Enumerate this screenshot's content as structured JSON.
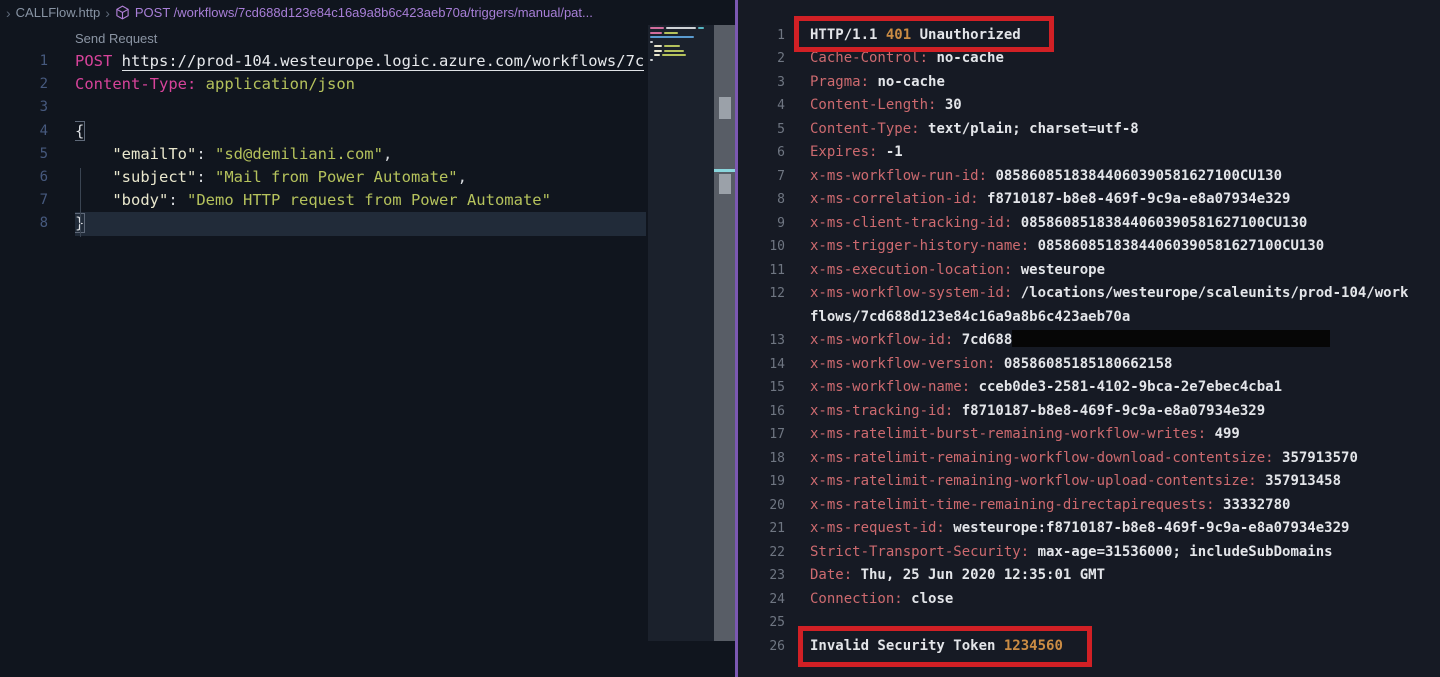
{
  "breadcrumb": {
    "root_chevron": "›",
    "file_label": "CALLFlow.http",
    "chevron": "›",
    "symbol_label": "POST /workflows/7cd688d123e84c16a9a8b6c423aeb70a/triggers/manual/pat..."
  },
  "request_editor": {
    "codelens_label": "Send Request",
    "lines": [
      {
        "n": "1",
        "seg": [
          [
            "kw",
            "POST "
          ],
          [
            "url",
            "https://prod-104.westeurope.logic.azure.com/workflows/7c"
          ]
        ]
      },
      {
        "n": "2",
        "seg": [
          [
            "kw",
            "Content-Type:"
          ],
          [
            "plain",
            " "
          ],
          [
            "str",
            "application/json"
          ]
        ]
      },
      {
        "n": "3",
        "seg": []
      },
      {
        "n": "4",
        "seg": [
          [
            "brace",
            "{"
          ]
        ]
      },
      {
        "n": "5",
        "seg": [
          [
            "plain",
            "    "
          ],
          [
            "key",
            "\"emailTo\""
          ],
          [
            "plain",
            ": "
          ],
          [
            "str",
            "\"sd@demiliani.com\""
          ],
          [
            "plain",
            ","
          ]
        ]
      },
      {
        "n": "6",
        "seg": [
          [
            "plain",
            "    "
          ],
          [
            "key",
            "\"subject\""
          ],
          [
            "plain",
            ": "
          ],
          [
            "str",
            "\"Mail from Power Automate\""
          ],
          [
            "plain",
            ","
          ]
        ]
      },
      {
        "n": "7",
        "seg": [
          [
            "plain",
            "    "
          ],
          [
            "key",
            "\"body\""
          ],
          [
            "plain",
            ": "
          ],
          [
            "str",
            "\"Demo HTTP request from Power Automate\""
          ]
        ]
      },
      {
        "n": "8",
        "cur": true,
        "seg": [
          [
            "brace",
            "}"
          ]
        ]
      }
    ]
  },
  "response_viewer": {
    "lines": [
      {
        "n": "1",
        "seg": [
          [
            "val",
            "HTTP/1.1 "
          ],
          [
            "num",
            "401"
          ],
          [
            "val",
            " Unauthorized"
          ]
        ]
      },
      {
        "n": "2",
        "seg": [
          [
            "hdr",
            "Cache-Control: "
          ],
          [
            "val",
            "no-cache"
          ]
        ]
      },
      {
        "n": "3",
        "seg": [
          [
            "hdr",
            "Pragma: "
          ],
          [
            "val",
            "no-cache"
          ]
        ]
      },
      {
        "n": "4",
        "seg": [
          [
            "hdr",
            "Content-Length: "
          ],
          [
            "val",
            "30"
          ]
        ]
      },
      {
        "n": "5",
        "seg": [
          [
            "hdr",
            "Content-Type: "
          ],
          [
            "val",
            "text/plain; charset=utf-8"
          ]
        ]
      },
      {
        "n": "6",
        "seg": [
          [
            "hdr",
            "Expires: "
          ],
          [
            "val",
            "-1"
          ]
        ]
      },
      {
        "n": "7",
        "seg": [
          [
            "hdr",
            "x-ms-workflow-run-id: "
          ],
          [
            "val",
            "08586085183844060390581627100CU130"
          ]
        ]
      },
      {
        "n": "8",
        "seg": [
          [
            "hdr",
            "x-ms-correlation-id: "
          ],
          [
            "val",
            "f8710187-b8e8-469f-9c9a-e8a07934e329"
          ]
        ]
      },
      {
        "n": "9",
        "seg": [
          [
            "hdr",
            "x-ms-client-tracking-id: "
          ],
          [
            "val",
            "08586085183844060390581627100CU130"
          ]
        ]
      },
      {
        "n": "10",
        "seg": [
          [
            "hdr",
            "x-ms-trigger-history-name: "
          ],
          [
            "val",
            "08586085183844060390581627100CU130"
          ]
        ]
      },
      {
        "n": "11",
        "seg": [
          [
            "hdr",
            "x-ms-execution-location: "
          ],
          [
            "val",
            "westeurope"
          ]
        ]
      },
      {
        "n": "12",
        "seg": [
          [
            "hdr",
            "x-ms-workflow-system-id: "
          ],
          [
            "val",
            "/locations/westeurope/scaleunits/prod-104/work"
          ]
        ]
      },
      {
        "n": "",
        "seg": [
          [
            "val",
            "flows/7cd688d123e84c16a9a8b6c423aeb70a"
          ]
        ]
      },
      {
        "n": "13",
        "seg": [
          [
            "hdr",
            "x-ms-workflow-id: "
          ],
          [
            "val",
            "7cd688"
          ],
          [
            "redact",
            ""
          ]
        ]
      },
      {
        "n": "14",
        "seg": [
          [
            "hdr",
            "x-ms-workflow-version: "
          ],
          [
            "val",
            "08586085185180662158"
          ]
        ]
      },
      {
        "n": "15",
        "seg": [
          [
            "hdr",
            "x-ms-workflow-name: "
          ],
          [
            "val",
            "cceb0de3-2581-4102-9bca-2e7ebec4cba1"
          ]
        ]
      },
      {
        "n": "16",
        "seg": [
          [
            "hdr",
            "x-ms-tracking-id: "
          ],
          [
            "val",
            "f8710187-b8e8-469f-9c9a-e8a07934e329"
          ]
        ]
      },
      {
        "n": "17",
        "seg": [
          [
            "hdr",
            "x-ms-ratelimit-burst-remaining-workflow-writes: "
          ],
          [
            "val",
            "499"
          ]
        ]
      },
      {
        "n": "18",
        "seg": [
          [
            "hdr",
            "x-ms-ratelimit-remaining-workflow-download-contentsize: "
          ],
          [
            "val",
            "357913570"
          ]
        ]
      },
      {
        "n": "19",
        "seg": [
          [
            "hdr",
            "x-ms-ratelimit-remaining-workflow-upload-contentsize: "
          ],
          [
            "val",
            "357913458"
          ]
        ]
      },
      {
        "n": "20",
        "seg": [
          [
            "hdr",
            "x-ms-ratelimit-time-remaining-directapirequests: "
          ],
          [
            "val",
            "33332780"
          ]
        ]
      },
      {
        "n": "21",
        "seg": [
          [
            "hdr",
            "x-ms-request-id: "
          ],
          [
            "val",
            "westeurope:f8710187-b8e8-469f-9c9a-e8a07934e329"
          ]
        ]
      },
      {
        "n": "22",
        "seg": [
          [
            "hdr",
            "Strict-Transport-Security: "
          ],
          [
            "val",
            "max-age=31536000; includeSubDomains"
          ]
        ]
      },
      {
        "n": "23",
        "seg": [
          [
            "hdr",
            "Date: "
          ],
          [
            "val",
            "Thu, 25 Jun 2020 12:35:01 GMT"
          ]
        ]
      },
      {
        "n": "24",
        "seg": [
          [
            "hdr",
            "Connection: "
          ],
          [
            "val",
            "close"
          ]
        ]
      },
      {
        "n": "25",
        "seg": []
      },
      {
        "n": "26",
        "seg": [
          [
            "val",
            "Invalid Security Token "
          ],
          [
            "num",
            "1234560"
          ]
        ]
      }
    ]
  },
  "minimap": {
    "rows": [
      {
        "o": 0,
        "bars": [
          [
            "#d16d9d",
            14
          ],
          [
            "#cfd2d6",
            30
          ],
          [
            "#56b6c2",
            6
          ]
        ]
      },
      {
        "o": 0,
        "bars": [
          [
            "#d16d9d",
            12
          ],
          [
            "#b5c25c",
            14
          ]
        ]
      },
      {
        "o": 0,
        "bars": [
          [
            "#5a9bd0",
            44
          ]
        ]
      },
      {
        "o": 0,
        "bars": [
          [
            "#cfd2d6",
            3
          ]
        ]
      },
      {
        "o": 4,
        "bars": [
          [
            "#e9e7cd",
            8
          ],
          [
            "#b5c25c",
            16
          ]
        ]
      },
      {
        "o": 4,
        "bars": [
          [
            "#e9e7cd",
            8
          ],
          [
            "#b5c25c",
            20
          ]
        ]
      },
      {
        "o": 4,
        "bars": [
          [
            "#e9e7cd",
            6
          ],
          [
            "#b5c25c",
            24
          ]
        ]
      },
      {
        "o": 0,
        "bars": [
          [
            "#cfd2d6",
            3
          ]
        ]
      }
    ]
  },
  "colors": {
    "editor_bg": "#10151e",
    "response_bg": "#161a24",
    "keyword_pink": "#d7439a",
    "string_yellow": "#b5c25c",
    "header_red": "#cd6a6f",
    "number_orange": "#cb8c44",
    "annotation_red": "#d12025",
    "divider_purple": "#7c58b2",
    "breadcrumb_symbol_purple": "#a87fd8"
  }
}
